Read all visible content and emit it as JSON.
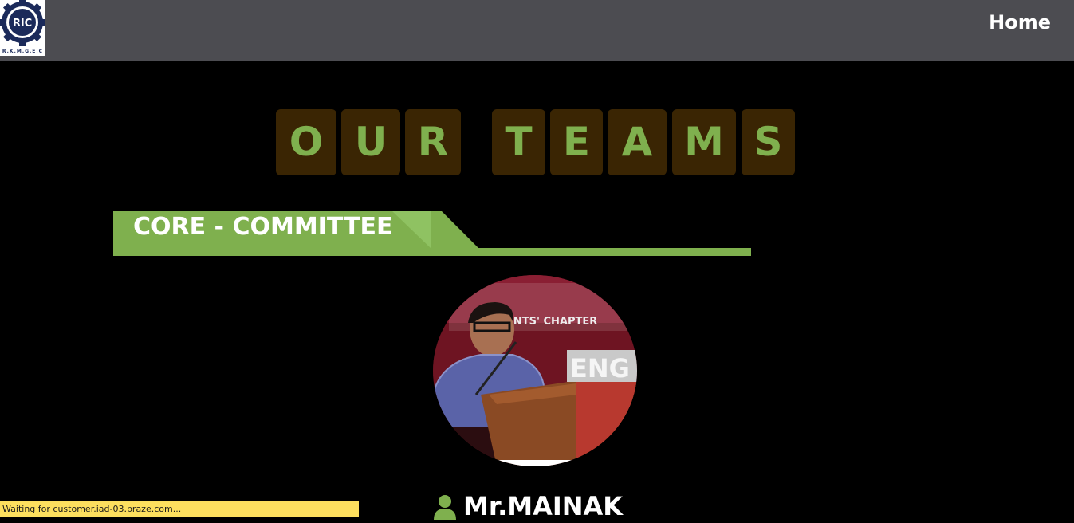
{
  "navbar": {
    "logo_text": "R.K.M.G.E.C",
    "logo_initials": "RIC",
    "home_label": "Home"
  },
  "title": {
    "letters": [
      "O",
      "U",
      "R",
      "T",
      "E",
      "A",
      "M",
      "S"
    ]
  },
  "section": {
    "heading": "CORE - COMMITTEE",
    "accent_color": "#7fb04e"
  },
  "member": {
    "name": "Mr.MAINAK",
    "photo_sign_text": "ENTS' CHAPTER"
  },
  "status_bar": {
    "text": "Waiting for customer.iad-03.braze.com..."
  },
  "colors": {
    "background": "#000000",
    "navbar": "#4c4c51",
    "tile_bg": "#3a2503",
    "tile_letter": "#7fb04e",
    "status_bar": "#fddf5e"
  }
}
